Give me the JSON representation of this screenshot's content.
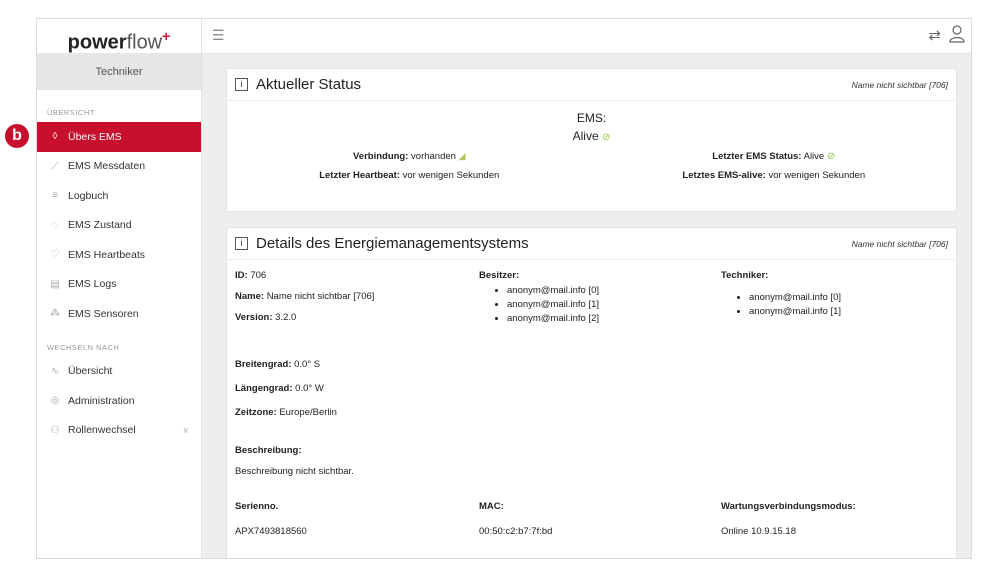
{
  "marker": "b",
  "logo": {
    "bold": "power",
    "light": "flow",
    "sup": "+"
  },
  "sidebar": {
    "role": "Techniker",
    "section1": "ÜBERSICHT",
    "items": [
      {
        "label": "Übers EMS",
        "icon": "drop-icon"
      },
      {
        "label": "EMS Messdaten",
        "icon": "chart-icon"
      },
      {
        "label": "Logbuch",
        "icon": "list-icon"
      },
      {
        "label": "EMS Zustand",
        "icon": "back-circle-icon"
      },
      {
        "label": "EMS Heartbeats",
        "icon": "heart-icon"
      },
      {
        "label": "EMS Logs",
        "icon": "document-icon"
      },
      {
        "label": "EMS Sensoren",
        "icon": "sensor-icon"
      }
    ],
    "section2": "WECHSELN NACH",
    "items2": [
      {
        "label": "Übersicht",
        "icon": "line-chart-icon"
      },
      {
        "label": "Administration",
        "icon": "settings-circle-icon"
      },
      {
        "label": "Rollenwechsel",
        "icon": "users-icon"
      }
    ]
  },
  "status": {
    "title": "Aktueller Status",
    "subtitle": "Name nicht sichtbar [706]",
    "ems_label": "EMS:",
    "ems_value": "Alive",
    "verbindung_label": "Verbindung:",
    "verbindung_value": "vorhanden",
    "letzter_status_label": "Letzter EMS Status:",
    "letzter_status_value": "Alive",
    "heartbeat_label": "Letzter Heartbeat:",
    "heartbeat_value": "vor wenigen Sekunden",
    "alive_label": "Letztes EMS-alive:",
    "alive_value": "vor wenigen Sekunden"
  },
  "details": {
    "title": "Details des Energiemanagementsystems",
    "subtitle": "Name nicht sichtbar [706]",
    "id_label": "ID:",
    "id_value": "706",
    "name_label": "Name:",
    "name_value": "Name nicht sichtbar [706]",
    "version_label": "Version:",
    "version_value": "3.2.0",
    "besitzer_label": "Besitzer:",
    "besitzer": [
      "anonym@mail.info [0]",
      "anonym@mail.info [1]",
      "anonym@mail.info [2]"
    ],
    "techniker_label": "Techniker:",
    "techniker": [
      "anonym@mail.info [0]",
      "anonym@mail.info [1]"
    ],
    "breitengrad_label": "Breitengrad:",
    "breitengrad_value": "0.0° S",
    "laengengrad_label": "Längengrad:",
    "laengengrad_value": "0.0° W",
    "zeitzone_label": "Zeitzone:",
    "zeitzone_value": "Europe/Berlin",
    "beschreibung_label": "Beschreibung:",
    "beschreibung_value": "Beschreibung nicht sichtbar.",
    "serienno_label": "Serienno.",
    "serienno_value": "APX7493818560",
    "mac_label": "MAC:",
    "mac_value": "00:50:c2:b7:7f:bd",
    "wartung_label": "Wartungsverbindungsmodus:",
    "wartung_value": "Online 10.9.15.18"
  }
}
